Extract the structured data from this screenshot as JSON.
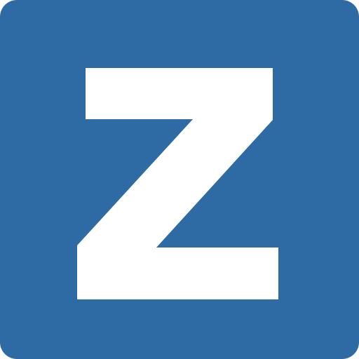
{
  "app_icon": {
    "icon": "z-logo-icon",
    "letter": "Z",
    "colors": {
      "background": "#2e6aa3",
      "letter": "#ffffff"
    }
  }
}
